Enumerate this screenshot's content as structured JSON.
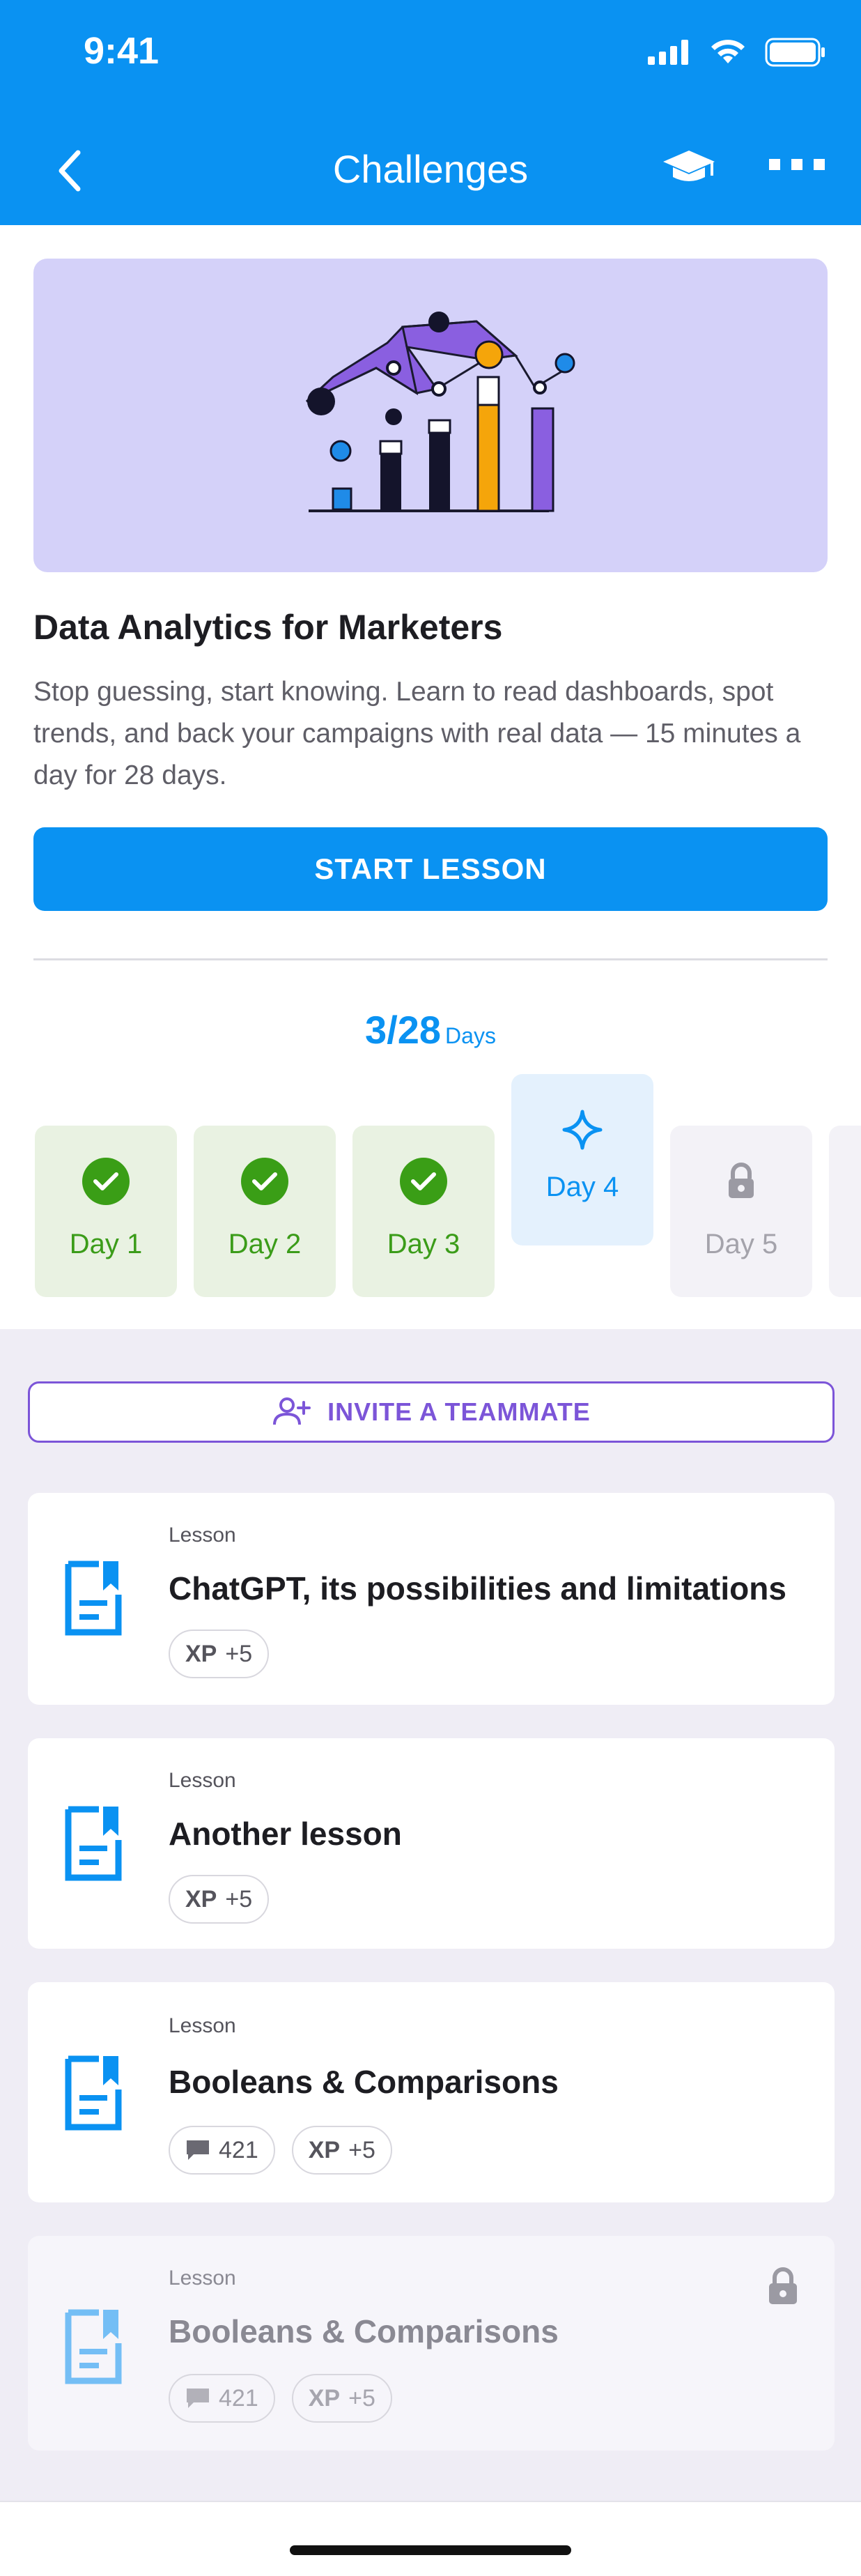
{
  "status_bar": {
    "time": "9:41"
  },
  "nav": {
    "title": "Challenges"
  },
  "course": {
    "title": "Data Analytics for Marketers",
    "description": "Stop guessing, start knowing. Learn to read dashboards, spot trends, and back your campaigns with real data — 15 minutes a day for 28 days.",
    "cta": "START LESSON"
  },
  "progress": {
    "value": "3/28",
    "unit": "Days"
  },
  "days": [
    {
      "label": "Day 1",
      "state": "done"
    },
    {
      "label": "Day 2",
      "state": "done"
    },
    {
      "label": "Day 3",
      "state": "done"
    },
    {
      "label": "Day 4",
      "state": "current"
    },
    {
      "label": "Day 5",
      "state": "locked"
    }
  ],
  "invite": {
    "label": "INVITE A TEAMMATE"
  },
  "lessons": [
    {
      "kind": "Lesson",
      "title": "ChatGPT, its possibilities and limitations",
      "xp_label": "XP",
      "xp_value": "+5"
    },
    {
      "kind": "Lesson",
      "title": "Another lesson",
      "xp_label": "XP",
      "xp_value": "+5"
    },
    {
      "kind": "Lesson",
      "title": "Booleans & Comparisons",
      "comments": "421",
      "xp_label": "XP",
      "xp_value": "+5"
    },
    {
      "kind": "Lesson",
      "title": "Booleans & Comparisons",
      "comments": "421",
      "xp_label": "XP",
      "xp_value": "+5",
      "locked": true
    }
  ],
  "colors": {
    "primary": "#0a92f2",
    "success": "#3a9e16",
    "accent": "#7c55d8",
    "hero_bg": "#d4d1f9"
  }
}
